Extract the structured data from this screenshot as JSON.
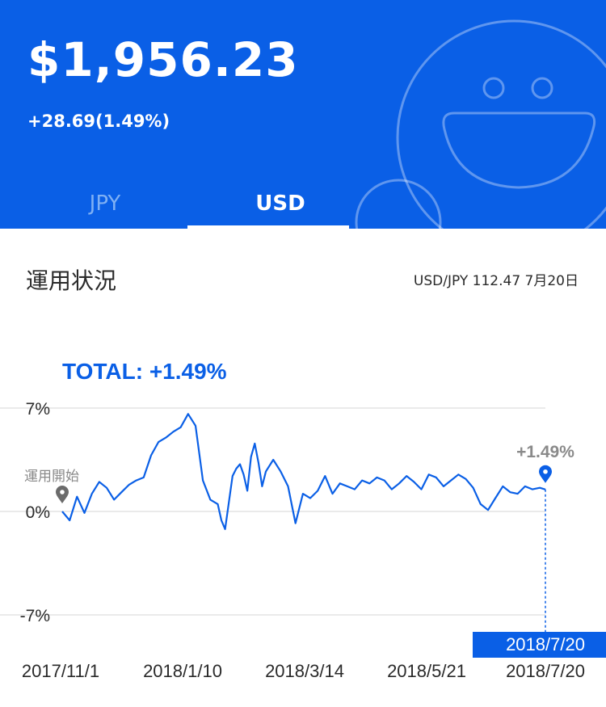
{
  "header": {
    "balance": "$1,956.23",
    "change": "+28.69(1.49%)",
    "mascot_icon": "smiling-face-icon",
    "background_color": "#0a5fe6"
  },
  "tabs": [
    {
      "label": "JPY",
      "active": false
    },
    {
      "label": "USD",
      "active": true
    }
  ],
  "section": {
    "title": "運用状況",
    "rate": "USD/JPY 112.47 7月20日"
  },
  "chart_data": {
    "type": "line",
    "title": "TOTAL: +1.49%",
    "y_tick_labels": [
      "7%",
      "0%",
      "-7%"
    ],
    "y_ticks": [
      7,
      0,
      -7
    ],
    "ylim": [
      -7,
      7
    ],
    "x_tick_labels": [
      "2017/11/1",
      "2018/1/10",
      "2018/3/14",
      "2018/5/21",
      "2018/7/20"
    ],
    "x_ticks": [
      0,
      70,
      133,
      201,
      261
    ],
    "start_marker_label": "運用開始",
    "end_value_label": "+1.49%",
    "end_date_label": "2018/7/20",
    "line_color": "#0a5fe6",
    "series": [
      {
        "x": [
          0,
          4,
          8,
          12,
          16,
          20,
          24,
          28,
          32,
          36,
          40,
          44,
          48,
          52,
          56,
          60,
          64,
          68,
          72,
          76,
          80,
          84,
          86,
          88,
          90,
          92,
          94,
          96,
          98,
          100,
          102,
          104,
          106,
          108,
          110,
          114,
          118,
          122,
          126,
          130,
          134,
          138,
          142,
          146,
          150,
          154,
          158,
          162,
          166,
          170,
          174,
          178,
          182,
          186,
          190,
          194,
          198,
          202,
          206,
          210,
          214,
          218,
          222,
          226,
          230,
          234,
          238,
          242,
          246,
          250,
          254,
          258,
          261
        ],
        "values": [
          0,
          -0.6,
          1,
          -0.1,
          1.2,
          2,
          1.6,
          0.8,
          1.3,
          1.8,
          2.1,
          2.3,
          3.8,
          4.7,
          5,
          5.4,
          5.7,
          6.6,
          5.8,
          2.1,
          0.8,
          0.5,
          -0.6,
          -1.2,
          0.6,
          2.4,
          2.9,
          3.2,
          2.5,
          1.4,
          3.7,
          4.6,
          3.3,
          1.7,
          2.7,
          3.5,
          2.7,
          1.7,
          -0.8,
          1.2,
          0.9,
          1.4,
          2.4,
          1.2,
          1.9,
          1.7,
          1.5,
          2.1,
          1.9,
          2.3,
          2.1,
          1.5,
          1.9,
          2.4,
          2,
          1.5,
          2.5,
          2.3,
          1.7,
          2.1,
          2.5,
          2.2,
          1.6,
          0.5,
          0.1,
          0.9,
          1.7,
          1.3,
          1.2,
          1.7,
          1.5,
          1.6,
          1.49
        ]
      }
    ]
  }
}
